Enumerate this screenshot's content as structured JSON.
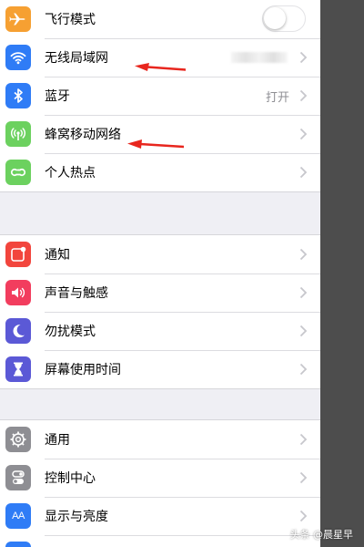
{
  "colors": {
    "airplane": "#f6a032",
    "wifi": "#2f7cf6",
    "bluetooth": "#2f7cf6",
    "cellular": "#6cd15f",
    "hotspot": "#6cd15f",
    "notifications": "#f2453d",
    "sounds": "#f23d5e",
    "dnd": "#5b59d6",
    "screen_time": "#5b59d6",
    "general": "#8e8e93",
    "control_center": "#8e8e93",
    "display": "#2f7cf6",
    "annotation_arrow": "#e8261e"
  },
  "group1": {
    "items": [
      {
        "label": "飞行模式",
        "icon": "airplane-icon",
        "control": "toggle",
        "toggle_on": false
      },
      {
        "label": "无线局域网",
        "icon": "wifi-icon",
        "value": "",
        "value_blurred": true
      },
      {
        "label": "蓝牙",
        "icon": "bluetooth-icon",
        "value": "打开"
      },
      {
        "label": "蜂窝移动网络",
        "icon": "cellular-icon"
      },
      {
        "label": "个人热点",
        "icon": "hotspot-icon"
      }
    ]
  },
  "group2": {
    "items": [
      {
        "label": "通知",
        "icon": "notifications-icon"
      },
      {
        "label": "声音与触感",
        "icon": "sounds-icon"
      },
      {
        "label": "勿扰模式",
        "icon": "moon-icon"
      },
      {
        "label": "屏幕使用时间",
        "icon": "hourglass-icon"
      }
    ]
  },
  "group3": {
    "items": [
      {
        "label": "通用",
        "icon": "gear-icon"
      },
      {
        "label": "控制中心",
        "icon": "toggles-icon"
      },
      {
        "label": "显示与亮度",
        "icon": "text-size-icon",
        "icon_text": "AA"
      }
    ]
  },
  "watermark": "头条 @晨星早"
}
